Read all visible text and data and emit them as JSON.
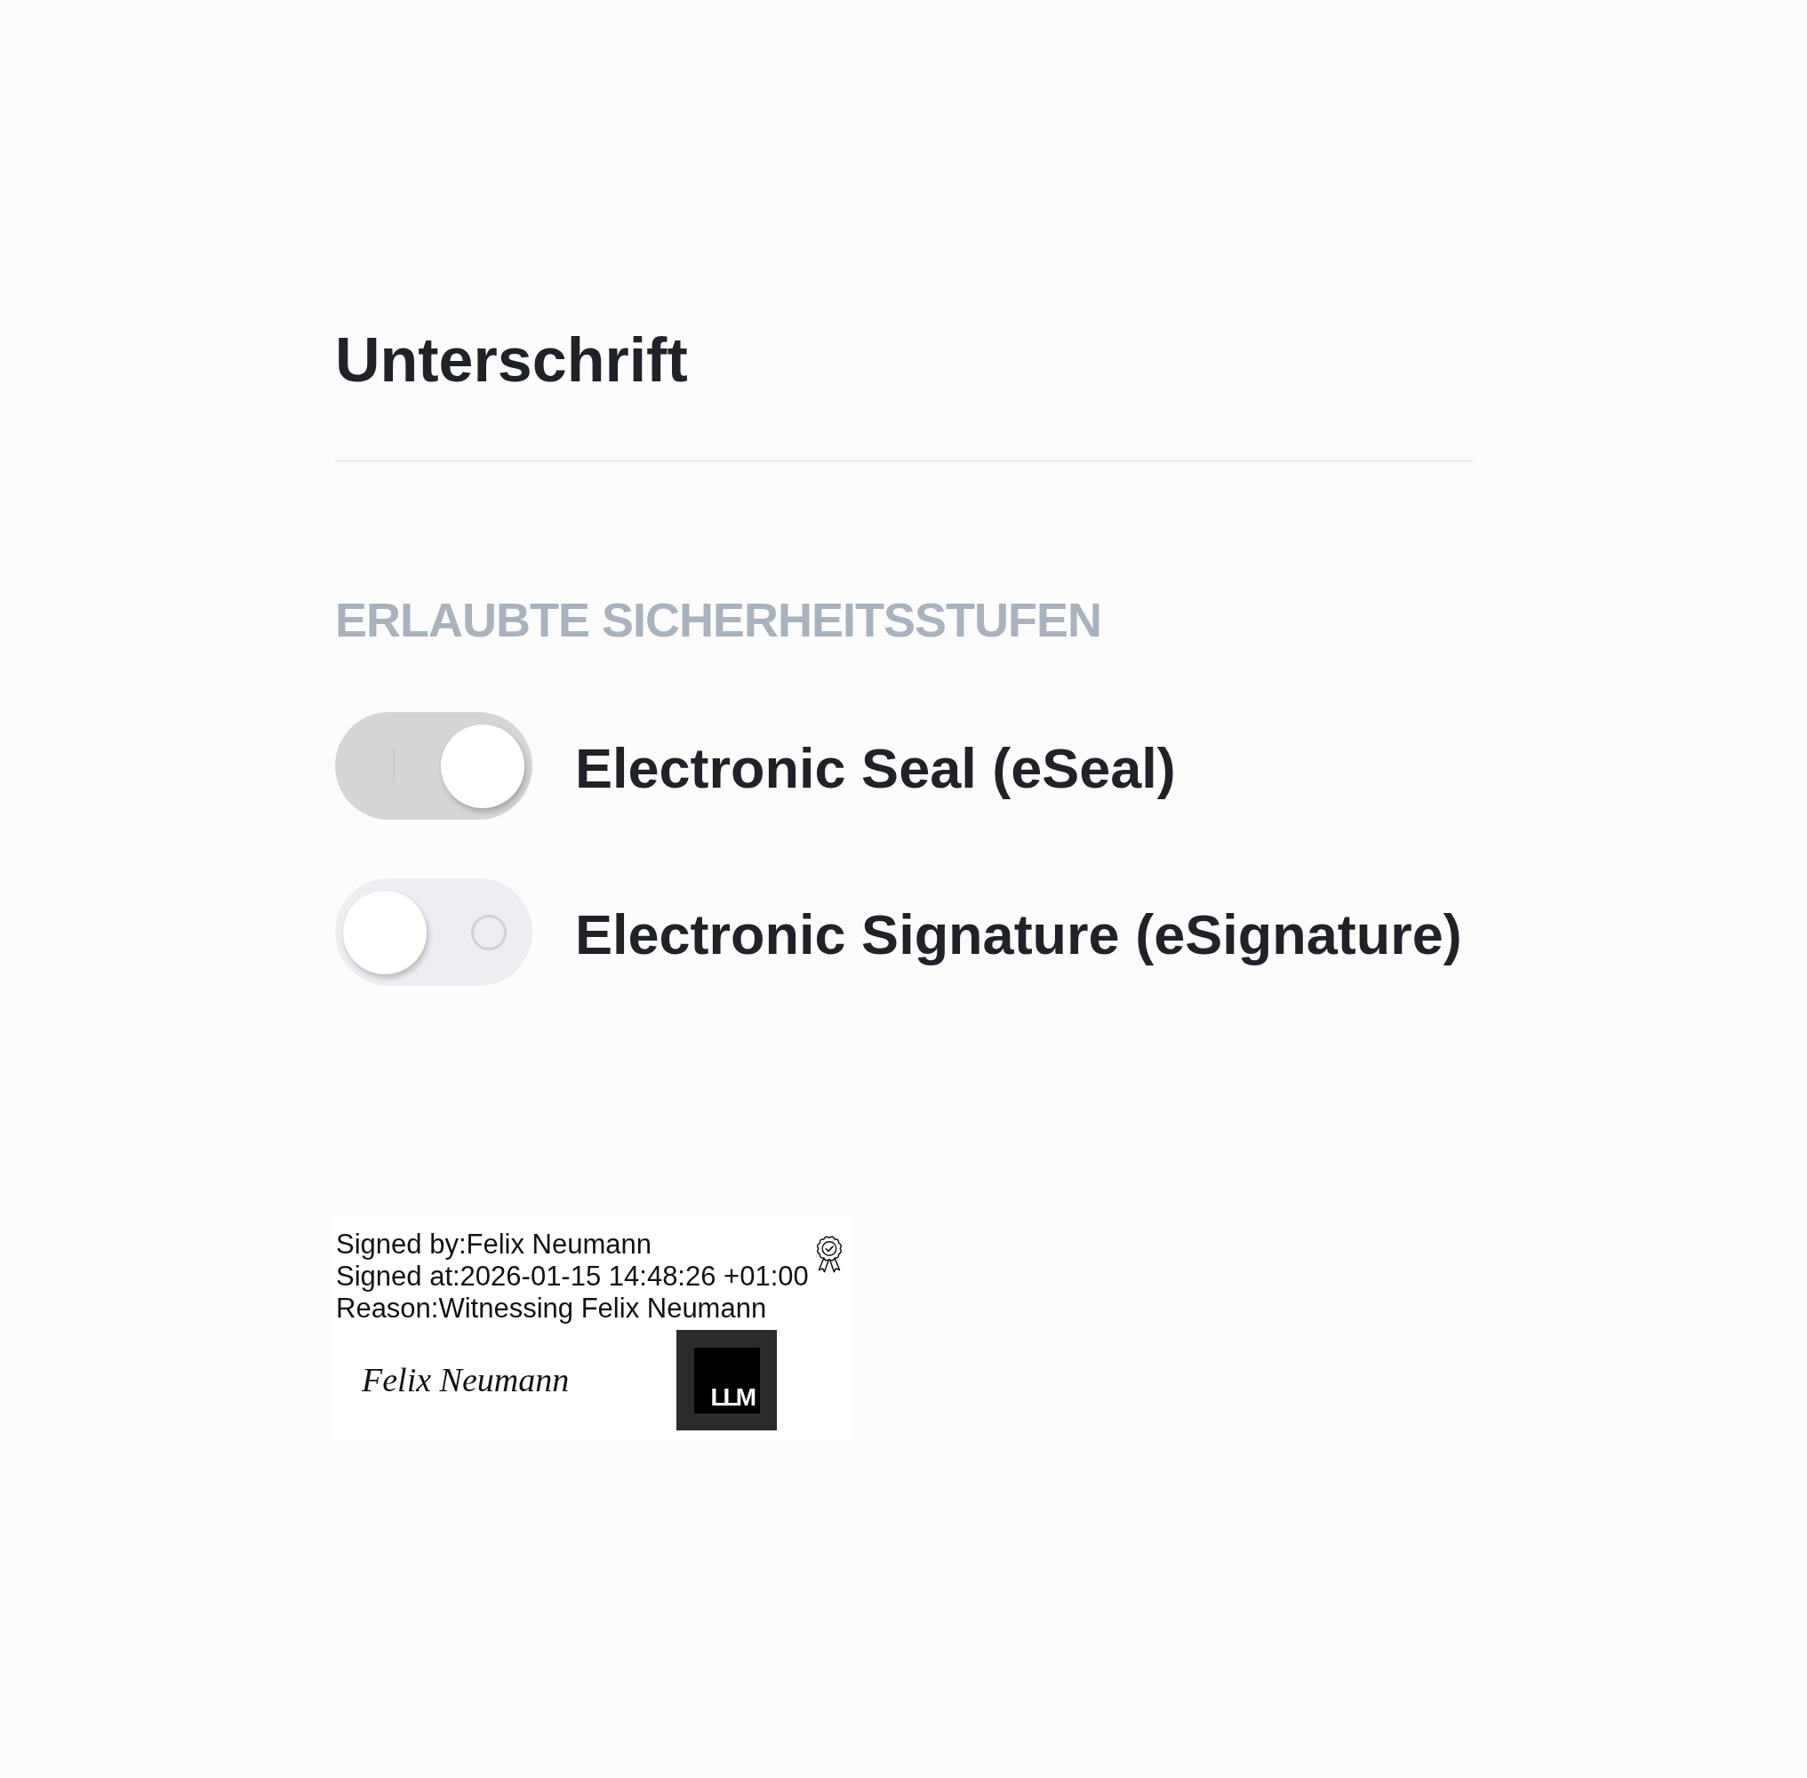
{
  "page": {
    "title": "Unterschrift"
  },
  "security_levels": {
    "heading": "ERLAUBTE SICHERHEITSSTUFEN",
    "options": [
      {
        "label": "Electronic Seal (eSeal)",
        "checked": true
      },
      {
        "label": "Electronic Signature (eSignature)",
        "checked": false
      }
    ]
  },
  "signature_stamp": {
    "lines": [
      "Signed by:Felix Neumann",
      "Signed at:2026-01-15 14:48:26 +01:00",
      "Reason:Witnessing Felix Neumann"
    ],
    "handwriting": "Felix Neumann",
    "logo_text": "LLM"
  }
}
